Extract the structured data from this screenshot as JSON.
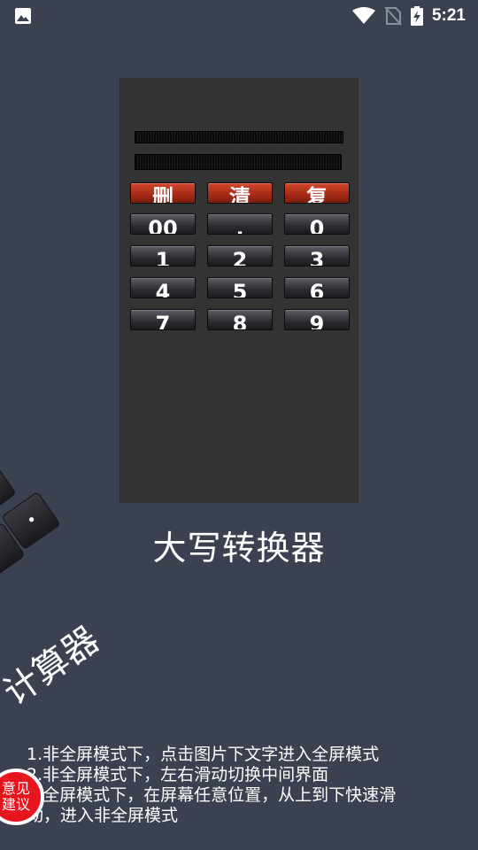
{
  "status_bar": {
    "time": "5:21",
    "icons": [
      "image-notification-icon",
      "wifi-icon",
      "no-sim-icon",
      "battery-charging-icon"
    ]
  },
  "preview": {
    "keys": [
      [
        "删",
        "清",
        "复"
      ],
      [
        "00",
        ".",
        "0"
      ],
      [
        "1",
        "2",
        "3"
      ],
      [
        "4",
        "5",
        "6"
      ],
      [
        "7",
        "8",
        "9"
      ]
    ]
  },
  "app_title": "大写转换器",
  "side_preview_title": "计算器",
  "instructions": [
    "1.非全屏模式下，点击图片下文字进入全屏模式",
    "2.非全屏模式下，左右滑动切换中间界面",
    "3.全屏模式下，在屏幕任意位置，从上到下快速滑",
    "动，进入非全屏模式"
  ],
  "feedback": {
    "line1": "意见",
    "line2": "建议"
  },
  "colors": {
    "background": "#3b4150",
    "key_red": "#b5301a",
    "feedback_red": "#e8141e"
  }
}
